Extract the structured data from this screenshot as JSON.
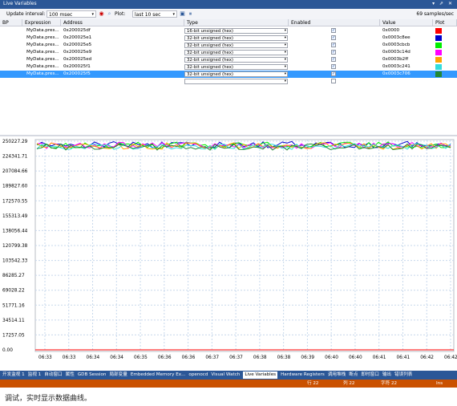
{
  "window": {
    "title": "Live Variables",
    "controls": "▾ ⇗ ✕"
  },
  "toolbar": {
    "update_label": "Update interval:",
    "update_value": "100 msec",
    "plot_label": "Plot:",
    "plot_value": "last 10 sec",
    "samples": "69 samples/sec"
  },
  "grid": {
    "columns": [
      "BP",
      "Expression",
      "Address",
      "Type",
      "Enabled",
      "Value",
      "Plot"
    ],
    "rows": [
      {
        "expression": "MyData.pres...",
        "address": "0x200025df",
        "type": "16-bit unsigned (hex)",
        "enabled": true,
        "value": "0x0000",
        "color": "#ff0000"
      },
      {
        "expression": "MyData.pres...",
        "address": "0x200025e1",
        "type": "32-bit unsigned (hex)",
        "enabled": true,
        "value": "0x0003c8ee",
        "color": "#0000cc"
      },
      {
        "expression": "MyData.pres...",
        "address": "0x200025e5",
        "type": "32-bit unsigned (hex)",
        "enabled": true,
        "value": "0x0003cbcb",
        "color": "#00ee00"
      },
      {
        "expression": "MyData.pres...",
        "address": "0x200025e9",
        "type": "32-bit unsigned (hex)",
        "enabled": true,
        "value": "0x0003c14d",
        "color": "#ff00ff"
      },
      {
        "expression": "MyData.pres...",
        "address": "0x200025ed",
        "type": "32-bit unsigned (hex)",
        "enabled": true,
        "value": "0x0003b2ff",
        "color": "#ffa500"
      },
      {
        "expression": "MyData.pres...",
        "address": "0x200025f1",
        "type": "32-bit unsigned (hex)",
        "enabled": true,
        "value": "0x0003c241",
        "color": "#33dddd"
      },
      {
        "expression": "MyData.pres...",
        "address": "0x200025f5",
        "type": "32-bit unsigned (hex)",
        "enabled": true,
        "value": "0x0003c706",
        "color": "#228833",
        "selected": true
      }
    ]
  },
  "chart": {
    "y_ticks": [
      "250227.29",
      "224341.71",
      "207084.66",
      "189827.60",
      "172570.55",
      "155313.49",
      "138056.44",
      "120799.38",
      "103542.33",
      "86285.27",
      "69028.22",
      "51771.16",
      "34514.11",
      "17257.05",
      "0.00"
    ],
    "x_ticks": [
      "06:33",
      "06:33",
      "06:34",
      "06:34",
      "06:35",
      "06:36",
      "06:36",
      "06:37",
      "06:37",
      "06:38",
      "06:38",
      "06:39",
      "06:40",
      "06:40",
      "06:41",
      "06:41",
      "06:42",
      "06:42"
    ]
  },
  "tabs": [
    "开发监视 1",
    "监视 1",
    "自动窗口",
    "属性",
    "GDB Session",
    "局部变量",
    "Embedded Memory Ex...",
    "openocd",
    "Visual Watch",
    "Live Variables",
    "Hardware Registers",
    "调用堆栈",
    "断点",
    "即时窗口",
    "输出",
    "错误列表"
  ],
  "active_tab": "Live Variables",
  "status": {
    "line": "行 22",
    "col": "列 22",
    "char": "字符 22",
    "mode": "Ins"
  },
  "caption": "调试，实时显示数据曲线。"
}
